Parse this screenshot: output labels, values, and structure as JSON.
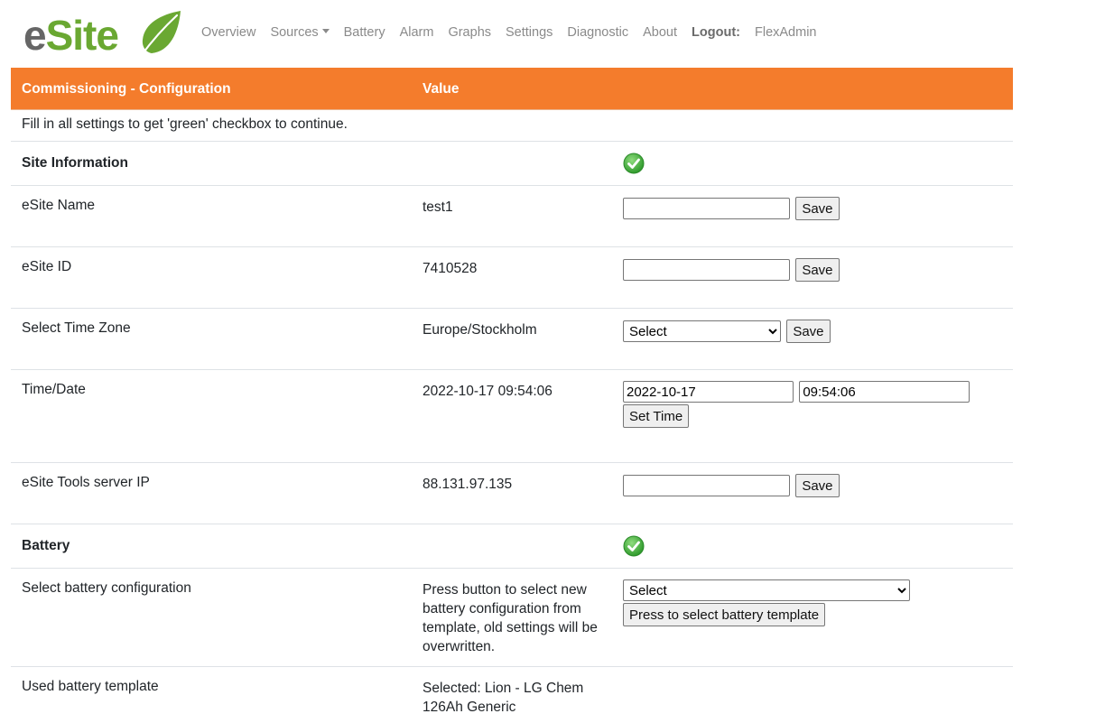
{
  "brand": {
    "part1": "e",
    "part2": "Site"
  },
  "nav": {
    "items": [
      "Overview",
      "Sources",
      "Battery",
      "Alarm",
      "Graphs",
      "Settings",
      "Diagnostic",
      "About"
    ],
    "logout_label": "Logout:",
    "user": "FlexAdmin"
  },
  "table": {
    "header": {
      "col1": "Commissioning - Configuration",
      "col2": "Value"
    },
    "intro": "Fill in all settings to get 'green' checkbox to continue.",
    "site_section": {
      "title": "Site Information",
      "status_icon": "check-circle-icon"
    },
    "rows": {
      "name": {
        "label": "eSite Name",
        "value": "test1",
        "input_value": "",
        "button": "Save"
      },
      "id": {
        "label": "eSite ID",
        "value": "7410528",
        "input_value": "",
        "button": "Save"
      },
      "timezone": {
        "label": "Select Time Zone",
        "value": "Europe/Stockholm",
        "select_value": "Select",
        "button": "Save"
      },
      "time": {
        "label": "Time/Date",
        "value": "2022-10-17 09:54:06",
        "date_input": "2022-10-17",
        "time_input": "09:54:06",
        "button": "Set Time"
      },
      "server": {
        "label": "eSite Tools server IP",
        "value": "88.131.97.135",
        "input_value": "",
        "button": "Save"
      }
    },
    "battery_section": {
      "title": "Battery",
      "status_icon": "check-circle-icon"
    },
    "battery_config": {
      "label": "Select battery configuration",
      "value": "Press button to select new battery configuration from template, old settings will be overwritten.",
      "select_value": "Select",
      "button": "Press to select battery template"
    },
    "battery_template": {
      "label": "Used battery template",
      "value": "Selected: Lion - LG Chem 126Ah Generic"
    }
  },
  "colors": {
    "header_bg": "#f47c2c",
    "brand_green": "#6aa832",
    "brand_gray": "#666666",
    "check_green": "#3aa335"
  }
}
